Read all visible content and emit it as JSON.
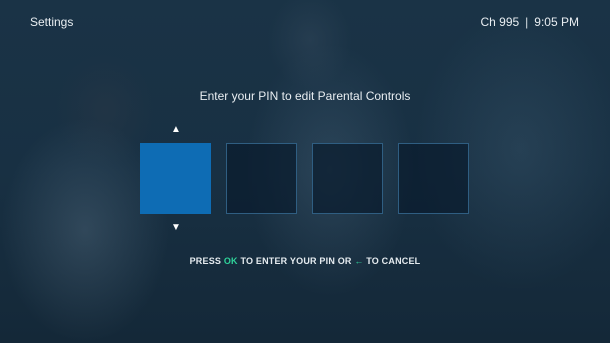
{
  "header": {
    "title": "Settings",
    "channel": "Ch 995",
    "separator": "|",
    "time": "9:05 PM"
  },
  "prompt": "Enter your PIN to edit Parental Controls",
  "pin": {
    "digits": [
      "",
      "",
      "",
      ""
    ],
    "active_index": 0,
    "up_arrow": "▲",
    "down_arrow": "▼"
  },
  "instruction": {
    "press": "PRESS",
    "ok": "OK",
    "middle": "TO ENTER YOUR PIN OR",
    "back_symbol": "←",
    "end": "TO CANCEL"
  },
  "colors": {
    "active_box": "#0e6cb4",
    "accent": "#2fd39a",
    "background": "#15293a"
  }
}
